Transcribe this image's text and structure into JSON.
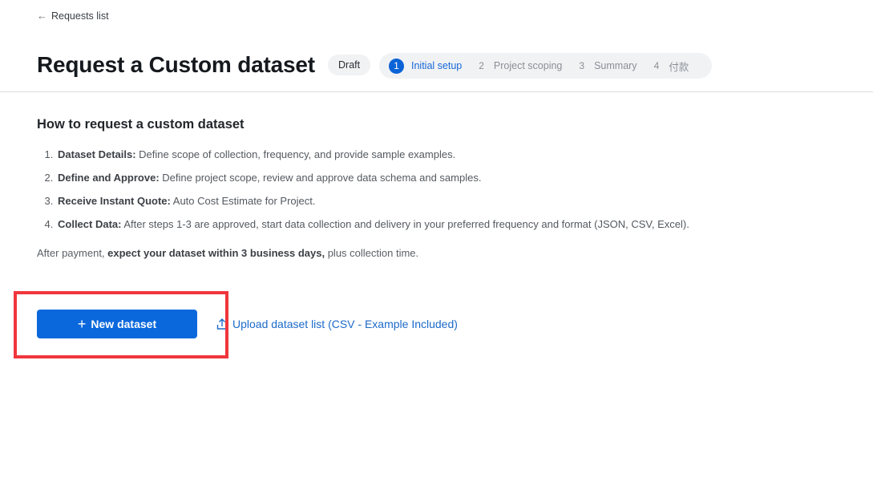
{
  "nav": {
    "back_label": "Requests list",
    "back_icon": "arrow-left-icon"
  },
  "header": {
    "title": "Request a Custom dataset",
    "status_badge": "Draft",
    "steps": [
      {
        "number": "1",
        "label": "Initial setup",
        "active": true
      },
      {
        "number": "2",
        "label": "Project scoping",
        "active": false
      },
      {
        "number": "3",
        "label": "Summary",
        "active": false
      },
      {
        "number": "4",
        "label": "付款",
        "active": false
      }
    ]
  },
  "content": {
    "section_title": "How to request a custom dataset",
    "steps": [
      {
        "bold": "Dataset Details:",
        "text": " Define scope of collection, frequency, and provide sample examples."
      },
      {
        "bold": "Define and Approve:",
        "text": " Define project scope, review and approve data schema and samples."
      },
      {
        "bold": "Receive Instant Quote:",
        "text": " Auto Cost Estimate for Project."
      },
      {
        "bold": "Collect Data:",
        "text": " After steps 1-3 are approved, start data collection and delivery in your preferred frequency and format (JSON, CSV, Excel)."
      }
    ],
    "note_prefix": "After payment, ",
    "note_bold": "expect your dataset within 3 business days,",
    "note_suffix": " plus collection time."
  },
  "actions": {
    "new_dataset_label": "New dataset",
    "new_dataset_icon": "plus-icon",
    "upload_label": "Upload dataset list (CSV - Example Included)",
    "upload_icon": "upload-icon"
  },
  "colors": {
    "primary": "#0b68dc",
    "link": "#1d6ac9",
    "highlight": "#f0363c"
  }
}
